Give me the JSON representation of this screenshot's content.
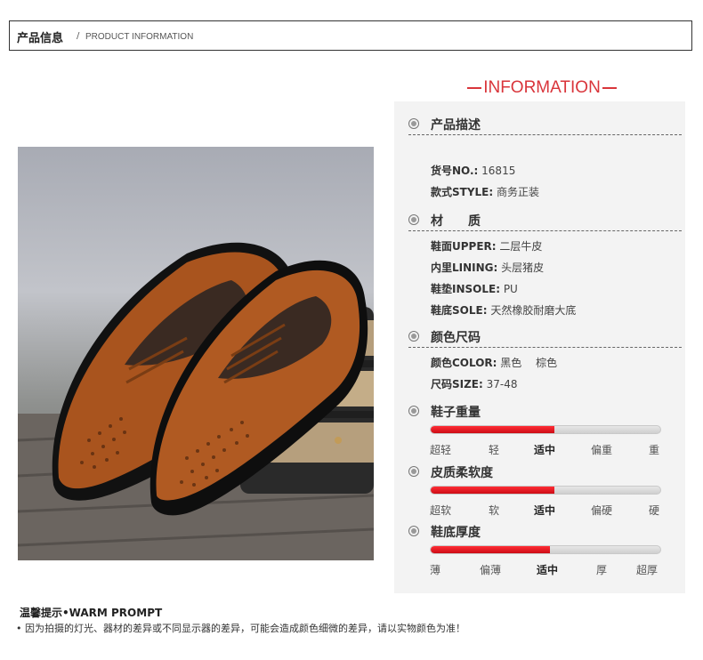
{
  "header": {
    "title": "产品信息",
    "separator": "/",
    "subtitle": "PRODUCT INFORMATION"
  },
  "info_heading": "INFORMATION",
  "sections": {
    "description": {
      "title": "产品描述",
      "rows": [
        {
          "key": "货号NO.:",
          "value": " 16815"
        },
        {
          "key": "款式STYLE:",
          "value": " 商务正装"
        }
      ]
    },
    "material": {
      "title": "材　　质",
      "rows": [
        {
          "key": "鞋面UPPER:",
          "value": " 二层牛皮"
        },
        {
          "key": "内里LINING:",
          "value": " 头层猪皮"
        },
        {
          "key": "鞋垫INSOLE:",
          "value": " PU"
        },
        {
          "key": "鞋底SOLE:",
          "value": " 天然橡胶耐磨大底"
        }
      ]
    },
    "color_size": {
      "title": "颜色尺码",
      "rows": [
        {
          "key": "颜色COLOR:",
          "value": " 黑色　 棕色"
        },
        {
          "key": "尺码SIZE:",
          "value": " 37-48"
        }
      ]
    },
    "weight": {
      "title": "鞋子重量",
      "level": 0.54,
      "labels": [
        "超轻",
        "轻",
        "适中",
        "偏重",
        "重"
      ],
      "selected": 2
    },
    "softness": {
      "title": "皮质柔软度",
      "level": 0.54,
      "labels": [
        "超软",
        "软",
        "适中",
        "偏硬",
        "硬"
      ],
      "selected": 2
    },
    "thickness": {
      "title": "鞋底厚度",
      "level": 0.52,
      "labels": [
        "薄",
        "偏薄",
        "适中",
        "厚",
        "超厚"
      ],
      "selected": 2
    }
  },
  "warm_prompt": {
    "title": "温馨提示•WARM PROMPT",
    "text": "• 因为拍摄的灯光、器材的差异或不同显示器的差异，可能会造成颜色细微的差异，请以实物颜色为准！"
  },
  "colors": {
    "accent": "#d9353b",
    "bar_fill": "#e0141d",
    "panel_bg": "#f3f3f3",
    "shoe_leather": "#a8551f"
  }
}
